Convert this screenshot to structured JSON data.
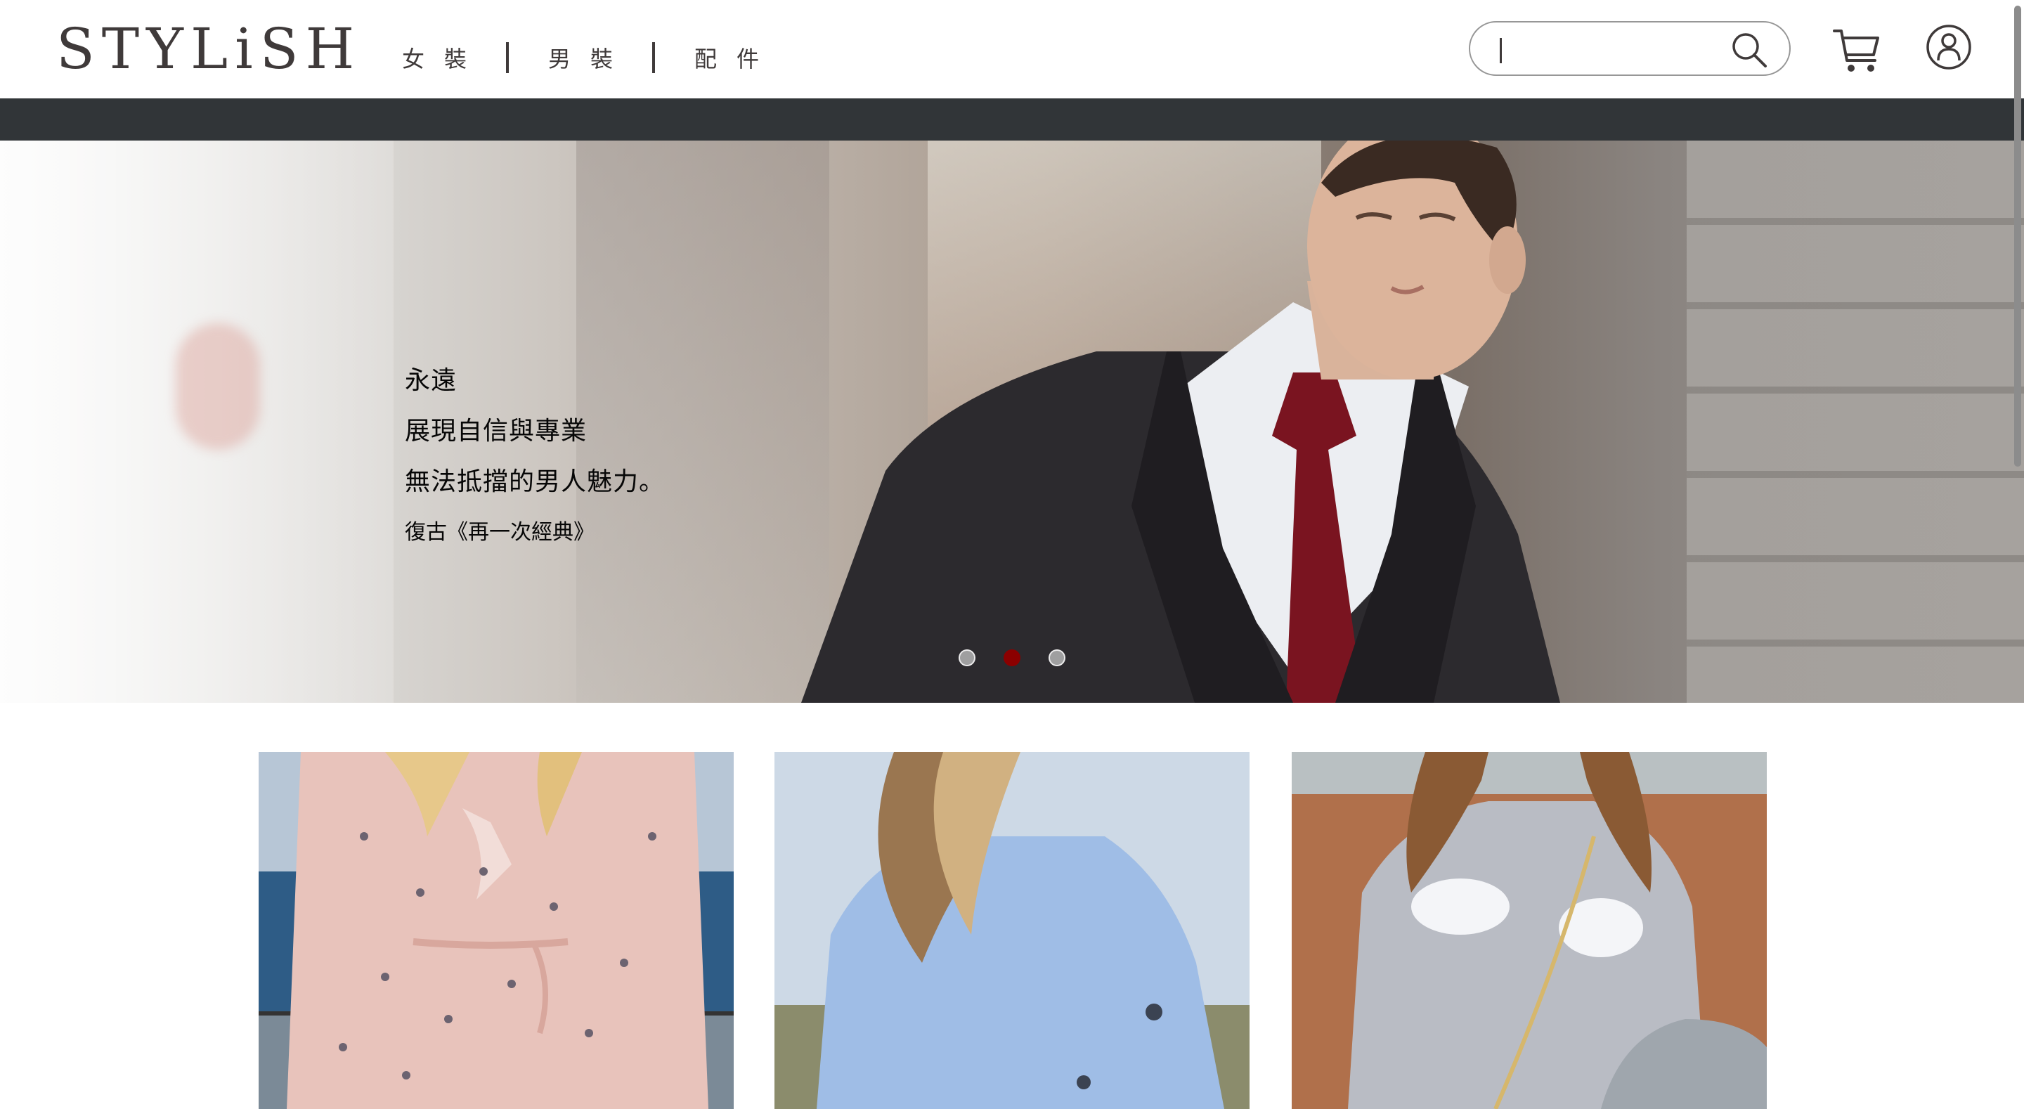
{
  "header": {
    "logo": "STYLiSH",
    "nav": [
      {
        "label": "女裝"
      },
      {
        "label": "男裝"
      },
      {
        "label": "配件"
      }
    ],
    "search": {
      "value": "",
      "placeholder": ""
    }
  },
  "hero": {
    "lines": [
      "永遠",
      "展現自信與專業",
      "無法抵擋的男人魅力。"
    ],
    "subline": "復古《再一次經典》",
    "dots_count": 3,
    "active_dot": 2
  },
  "colors": {
    "brand_text": "#3f3a3a",
    "strip": "#313538",
    "active_dot": "#8b0000"
  },
  "icons": [
    "search-icon",
    "cart-icon",
    "member-icon"
  ]
}
